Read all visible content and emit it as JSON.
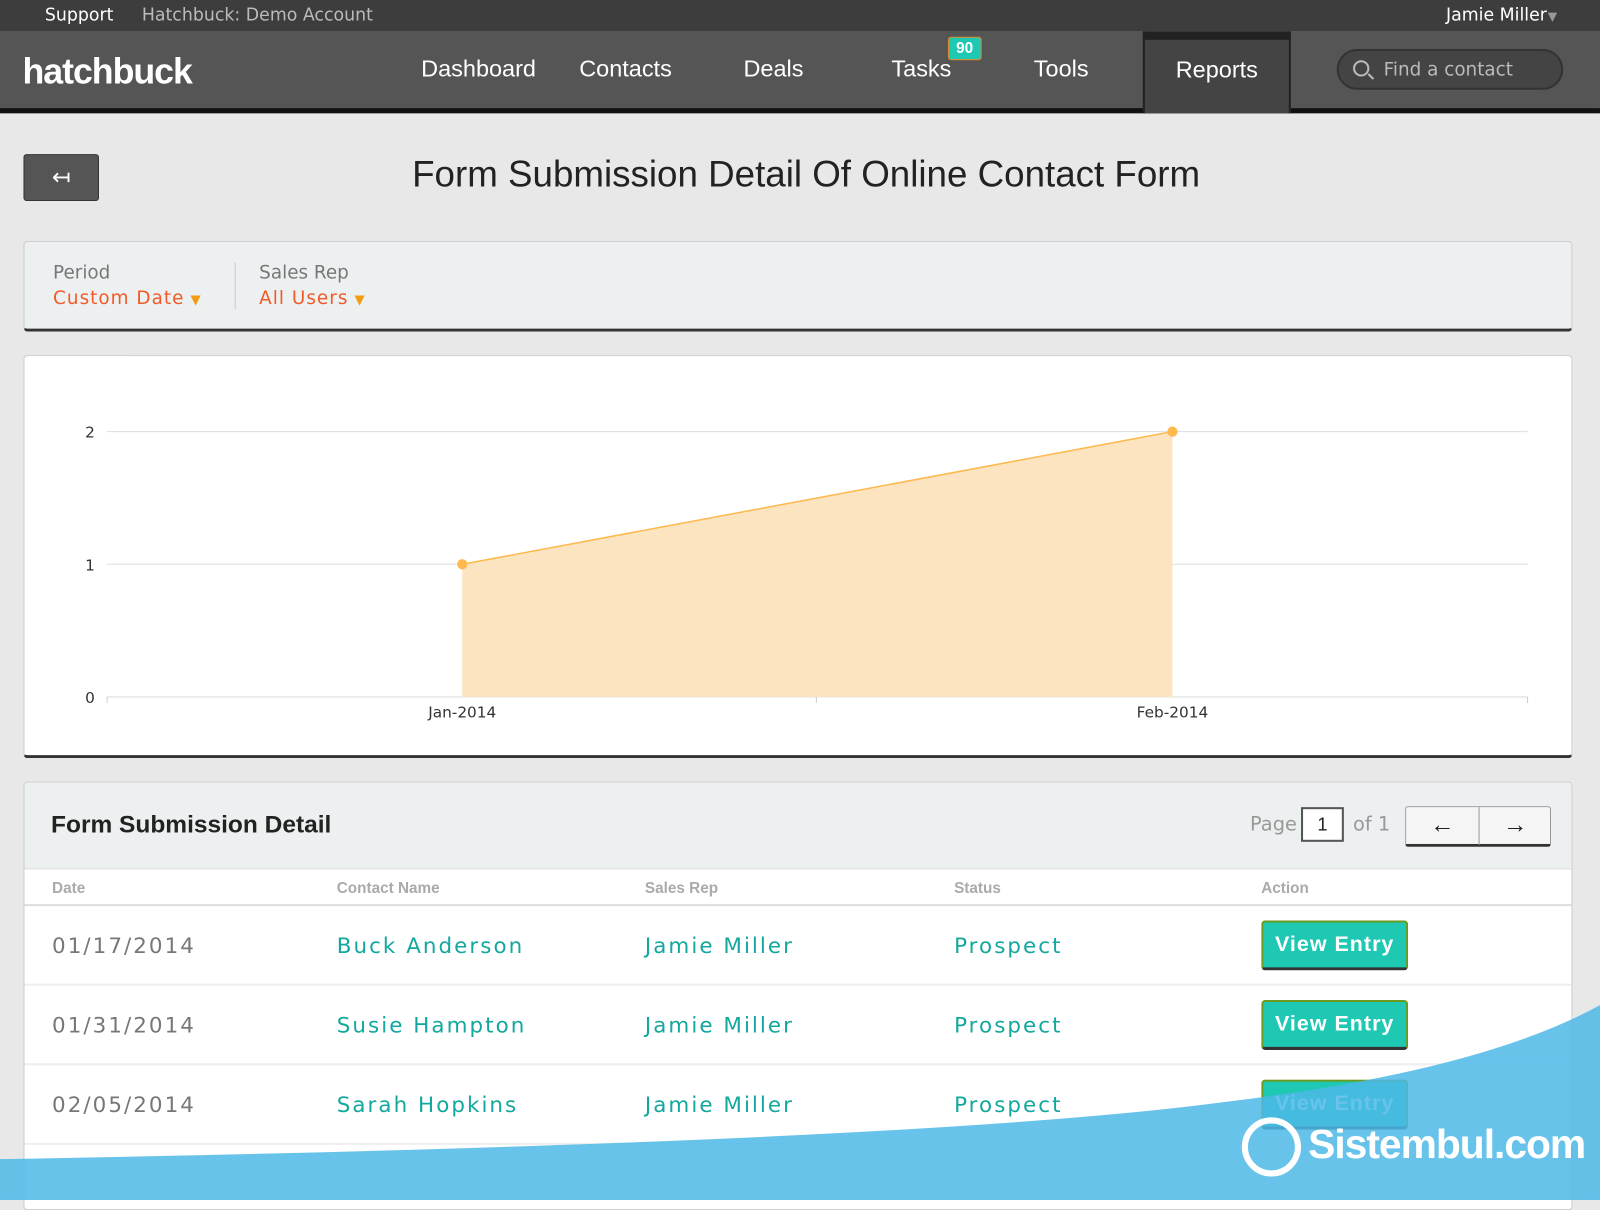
{
  "topbar": {
    "support": "Support",
    "account": "Hatchbuck: Demo Account",
    "user": "Jamie Miller"
  },
  "nav": {
    "logo": "hatchbuck",
    "items": [
      "Dashboard",
      "Contacts",
      "Deals",
      "Tasks",
      "Tools",
      "Reports"
    ],
    "active": "Reports",
    "tasks_badge": "90",
    "search_placeholder": "Find a contact"
  },
  "page": {
    "title": "Form Submission Detail Of Online Contact Form"
  },
  "filters": {
    "period_label": "Period",
    "period_value": "Custom Date",
    "salesrep_label": "Sales Rep",
    "salesrep_value": "All Users"
  },
  "chart_data": {
    "type": "area",
    "categories": [
      "Jan-2014",
      "Feb-2014"
    ],
    "values": [
      1,
      2
    ],
    "ylim": [
      0,
      2
    ],
    "yticks": [
      "0",
      "1",
      "2"
    ],
    "grid": true,
    "color": "#fdb94e",
    "fill": "#fde4c0"
  },
  "table": {
    "title": "Form Submission Detail",
    "page_label": "Page",
    "page": "1",
    "of_label": "of 1",
    "prev": "←",
    "next": "→",
    "columns": [
      "Date",
      "Contact Name",
      "Sales Rep",
      "Status",
      "Action"
    ],
    "rows": [
      {
        "date": "01/17/2014",
        "contact": "Buck Anderson",
        "rep": "Jamie Miller",
        "status": "Prospect",
        "action": "View Entry"
      },
      {
        "date": "01/31/2014",
        "contact": "Susie Hampton",
        "rep": "Jamie Miller",
        "status": "Prospect",
        "action": "View Entry"
      },
      {
        "date": "02/05/2014",
        "contact": "Sarah Hopkins",
        "rep": "Jamie Miller",
        "status": "Prospect",
        "action": "View Entry"
      }
    ]
  },
  "watermark": "Sistembul.com"
}
